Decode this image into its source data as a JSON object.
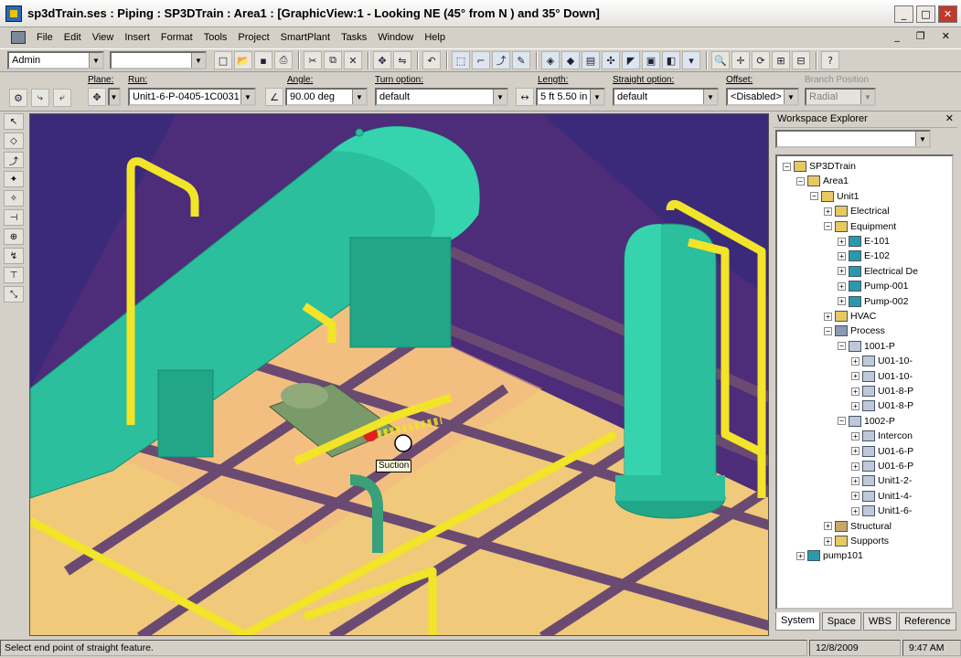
{
  "window": {
    "title": "sp3dTrain.ses : Piping : SP3DTrain : Area1 : [GraphicView:1 - Looking NE (45° from N ) and 35° Down]",
    "buttons": {
      "minimize": "_",
      "maximize": "□",
      "close": "✕"
    }
  },
  "menu": [
    "File",
    "Edit",
    "View",
    "Insert",
    "Format",
    "Tools",
    "Project",
    "SmartPlant",
    "Tasks",
    "Window",
    "Help"
  ],
  "toolbar": {
    "role_combo": "Admin",
    "filter_combo": "",
    "icons": [
      "new-icon",
      "open-icon",
      "save-icon",
      "print-icon",
      "cut-icon",
      "copy-icon",
      "paste-icon",
      "delete-icon",
      "move-icon",
      "undo-icon",
      "select-icon",
      "pipe-icon",
      "route-icon",
      "insert-icon",
      "view-icon",
      "zoom-icon",
      "pan-icon",
      "rotate-icon",
      "fit-icon",
      "help-icon"
    ]
  },
  "ribbon": {
    "plane": {
      "label": "Plane:",
      "value": ""
    },
    "run": {
      "label": "Run:",
      "value": "Unit1-6-P-0405-1C0031"
    },
    "angle": {
      "label": "Angle:",
      "value": "90.00 deg"
    },
    "turn_option": {
      "label": "Turn option:",
      "value": "default"
    },
    "length": {
      "label": "Length:",
      "value": "5 ft  5.50 in"
    },
    "straight_option": {
      "label": "Straight option:",
      "value": "default"
    },
    "offset": {
      "label": "Offset:",
      "value": "<Disabled>"
    },
    "branch_position": {
      "label": "Branch Position",
      "value": "Radial"
    }
  },
  "viewport": {
    "tooltip": "Suction",
    "colors": {
      "background": "#3b2a7a",
      "equipment": "#2bbf9d",
      "pipe": "#f2e428",
      "deck": "#f0c97a",
      "steel": "#6b4a72"
    }
  },
  "explorer": {
    "title": "Workspace Explorer",
    "filter": "",
    "tree": [
      {
        "label": "SP3DTrain",
        "level": 0,
        "icon": "plant",
        "expanded": true
      },
      {
        "label": "Area1",
        "level": 1,
        "icon": "folder",
        "expanded": true
      },
      {
        "label": "Unit1",
        "level": 2,
        "icon": "folder",
        "expanded": true
      },
      {
        "label": "Electrical",
        "level": 3,
        "icon": "folder",
        "expanded": false
      },
      {
        "label": "Equipment",
        "level": 3,
        "icon": "folder",
        "expanded": true
      },
      {
        "label": "E-101",
        "level": 4,
        "icon": "eq",
        "expanded": false
      },
      {
        "label": "E-102",
        "level": 4,
        "icon": "eq",
        "expanded": false
      },
      {
        "label": "Electrical De",
        "level": 4,
        "icon": "eq",
        "expanded": false
      },
      {
        "label": "Pump-001",
        "level": 4,
        "icon": "eq",
        "expanded": false
      },
      {
        "label": "Pump-002",
        "level": 4,
        "icon": "eq",
        "expanded": false
      },
      {
        "label": "HVAC",
        "level": 3,
        "icon": "folder",
        "expanded": false
      },
      {
        "label": "Process",
        "level": 3,
        "icon": "proc",
        "expanded": true
      },
      {
        "label": "1001-P",
        "level": 4,
        "icon": "pipe",
        "expanded": true
      },
      {
        "label": "U01-10-",
        "level": 5,
        "icon": "pipe",
        "expanded": false
      },
      {
        "label": "U01-10-",
        "level": 5,
        "icon": "pipe",
        "expanded": false
      },
      {
        "label": "U01-8-P",
        "level": 5,
        "icon": "pipe",
        "expanded": false
      },
      {
        "label": "U01-8-P",
        "level": 5,
        "icon": "pipe",
        "expanded": false
      },
      {
        "label": "1002-P",
        "level": 4,
        "icon": "pipe",
        "expanded": true
      },
      {
        "label": "Intercon",
        "level": 5,
        "icon": "pipe",
        "expanded": false
      },
      {
        "label": "U01-6-P",
        "level": 5,
        "icon": "pipe",
        "expanded": false
      },
      {
        "label": "U01-6-P",
        "level": 5,
        "icon": "pipe",
        "expanded": false
      },
      {
        "label": "Unit1-2-",
        "level": 5,
        "icon": "pipe",
        "expanded": false
      },
      {
        "label": "Unit1-4-",
        "level": 5,
        "icon": "pipe",
        "expanded": false
      },
      {
        "label": "Unit1-6-",
        "level": 5,
        "icon": "pipe",
        "expanded": false
      },
      {
        "label": "Structural",
        "level": 3,
        "icon": "struct",
        "expanded": false
      },
      {
        "label": "Supports",
        "level": 3,
        "icon": "folder",
        "expanded": false
      },
      {
        "label": "pump101",
        "level": 1,
        "icon": "eq",
        "expanded": false
      }
    ],
    "tabs": [
      "System",
      "Space",
      "WBS",
      "Reference"
    ],
    "active_tab": "System"
  },
  "status": {
    "message": "Select end point of straight feature.",
    "date": "12/8/2009",
    "time": "9:47 AM"
  }
}
